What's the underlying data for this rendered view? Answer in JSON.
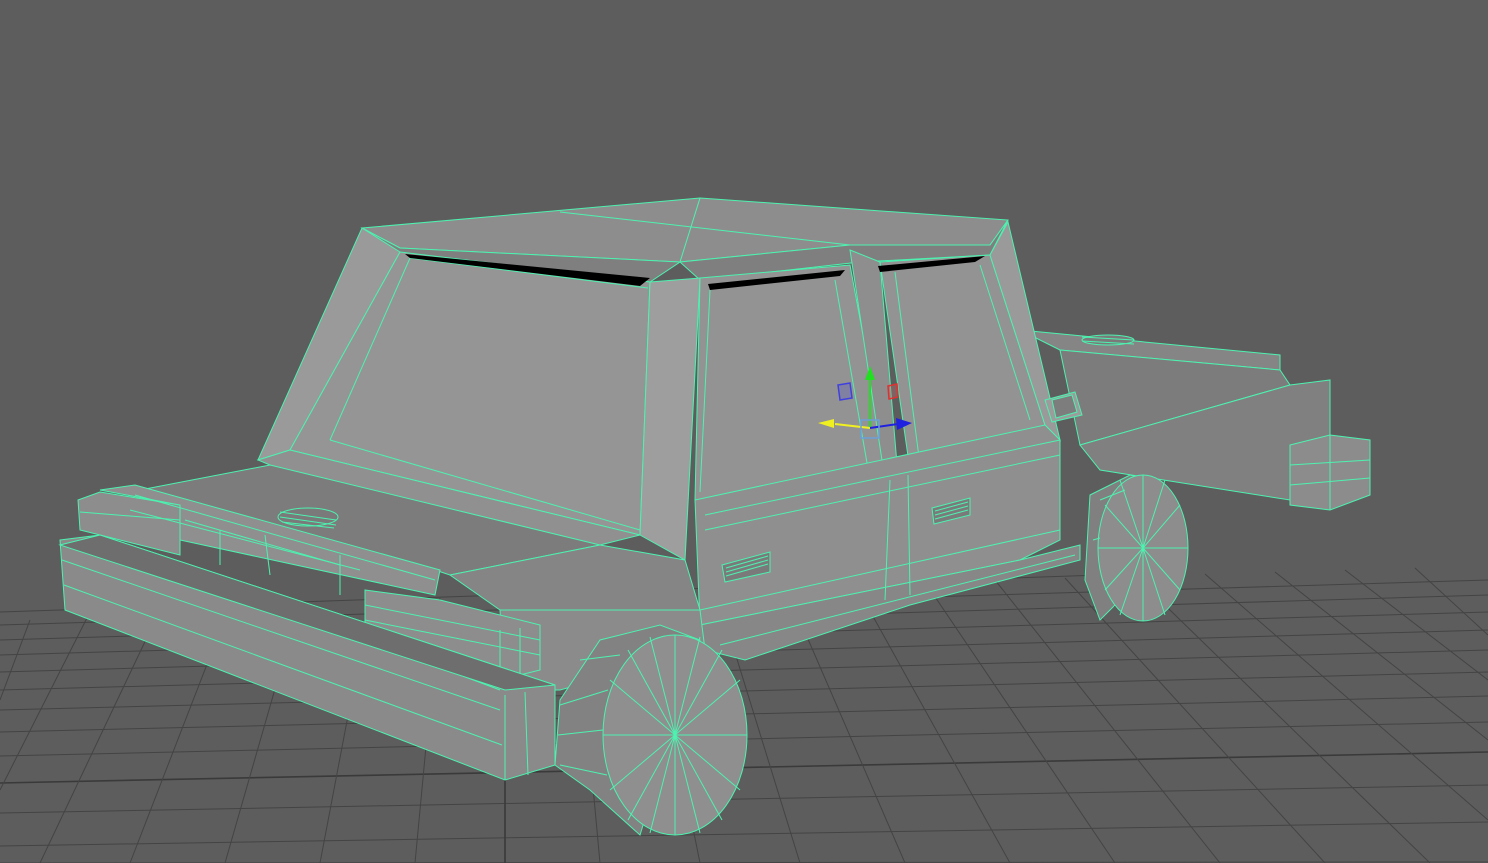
{
  "viewport": {
    "background_color": "#5d5d5d",
    "grid_color": "#444444",
    "wireframe_color": "#4df2b0",
    "object_face_light": "#9a9a9a",
    "object_face_mid": "#8a8a8a",
    "object_face_dark": "#7a7a7a"
  },
  "selection": {
    "object": "car-mesh",
    "tool": "move-manipulator"
  },
  "manipulator": {
    "x_axis_color": "#e03030",
    "y_axis_color": "#20e020",
    "z_axis_color": "#2020e0",
    "active_axis_color": "#f0f020",
    "center_color": "#6aa0d8"
  }
}
